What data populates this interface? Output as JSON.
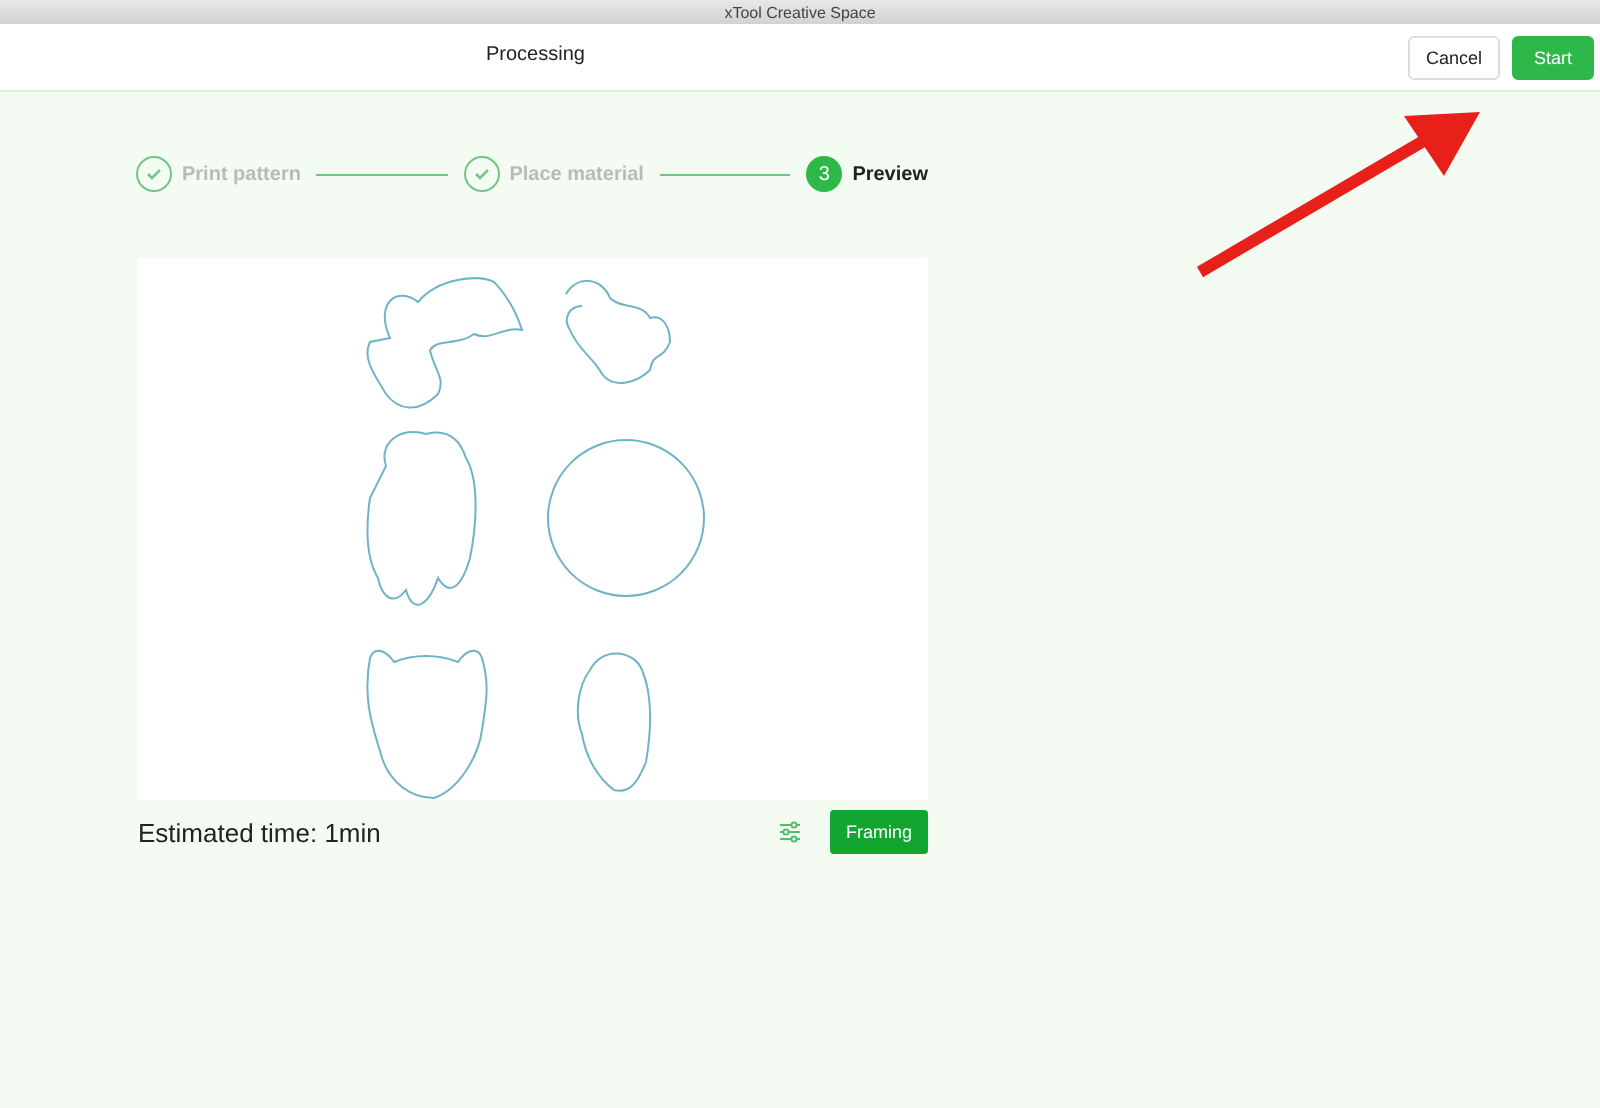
{
  "window": {
    "title": "xTool Creative Space"
  },
  "header": {
    "title": "Processing",
    "buttons": [
      {
        "label": "Cancel",
        "kind": "secondary"
      },
      {
        "label": "Start",
        "kind": "primary"
      }
    ]
  },
  "steps": [
    {
      "label": "Print pattern",
      "completed": true,
      "selected": false
    },
    {
      "label": "Place material",
      "completed": true,
      "selected": false
    },
    {
      "label": "Preview",
      "number": "3",
      "completed": false,
      "selected": true
    }
  ],
  "preview": {
    "estimate": "Estimated time: 1min",
    "button": "Framing"
  }
}
